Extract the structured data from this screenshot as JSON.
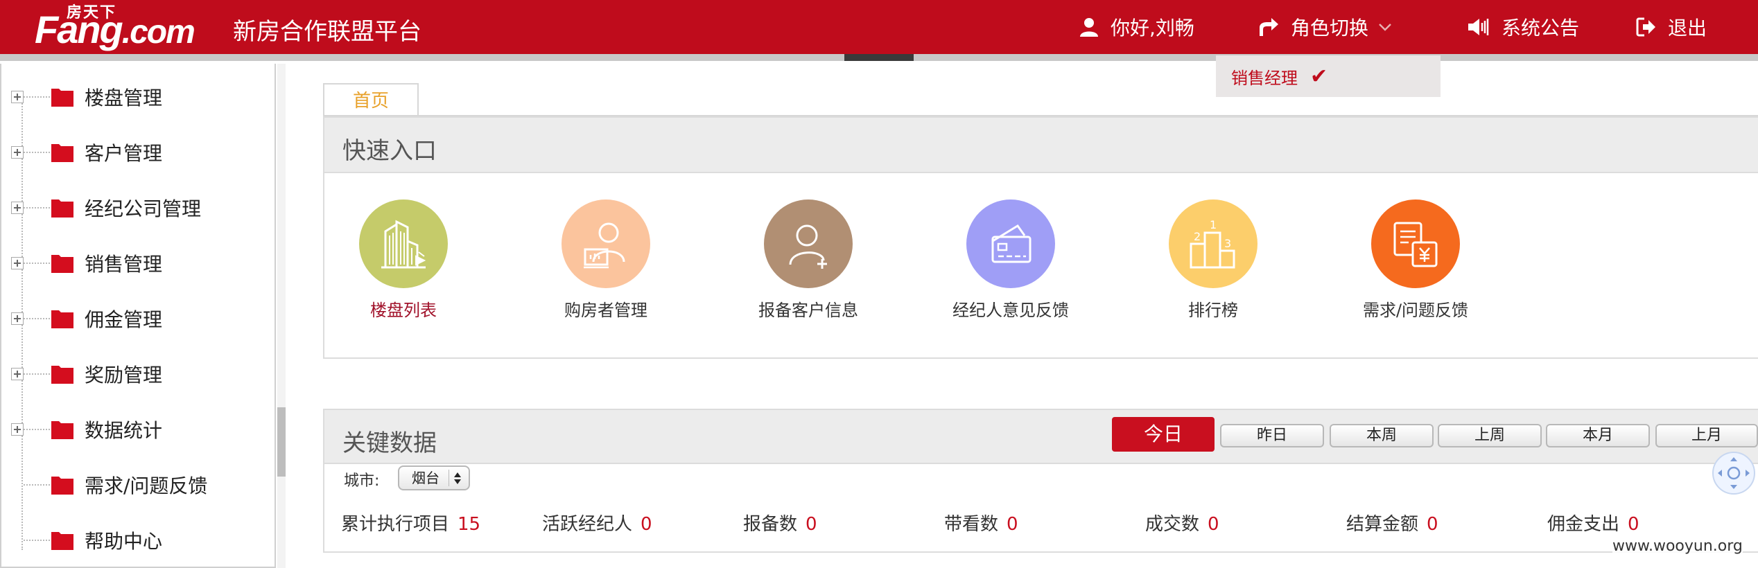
{
  "header": {
    "logo_sub": "房天下",
    "logo_main": "Fang",
    "logo_domain": ".com",
    "site_title": "新房合作联盟平台",
    "greeting": "你好,刘畅",
    "role_switch": "角色切换",
    "notice": "系统公告",
    "logout": "退出"
  },
  "role_dropdown": {
    "option": "销售经理",
    "check": "✔"
  },
  "sidebar": {
    "items": [
      {
        "label": "楼盘管理"
      },
      {
        "label": "客户管理"
      },
      {
        "label": "经纪公司管理"
      },
      {
        "label": "销售管理"
      },
      {
        "label": "佣金管理"
      },
      {
        "label": "奖励管理"
      },
      {
        "label": "数据统计"
      },
      {
        "label": "需求/问题反馈"
      },
      {
        "label": "帮助中心"
      }
    ]
  },
  "tabs": {
    "home": "首页"
  },
  "quick_entry": {
    "title": "快速入口",
    "items": [
      {
        "label": "楼盘列表",
        "color": "#c5cb6a",
        "icon": "buildings-icon"
      },
      {
        "label": "购房者管理",
        "color": "#fbc49d",
        "icon": "buyer-icon"
      },
      {
        "label": "报备客户信息",
        "color": "#b18f73",
        "icon": "add-user-icon"
      },
      {
        "label": "经纪人意见反馈",
        "color": "#9f9ef6",
        "icon": "card-icon"
      },
      {
        "label": "排行榜",
        "color": "#fcce6b",
        "icon": "podium-icon"
      },
      {
        "label": "需求/问题反馈",
        "color": "#f56a1e",
        "icon": "yuan-document-icon"
      }
    ]
  },
  "key_data": {
    "title": "关键数据",
    "periods": [
      "今日",
      "昨日",
      "本周",
      "上周",
      "本月",
      "上月"
    ],
    "city_label": "城市:",
    "city_value": "烟台",
    "stats": [
      {
        "label": "累计执行项目",
        "value": "15"
      },
      {
        "label": "活跃经纪人",
        "value": "0"
      },
      {
        "label": "报备数",
        "value": "0"
      },
      {
        "label": "带看数",
        "value": "0"
      },
      {
        "label": "成交数",
        "value": "0"
      },
      {
        "label": "结算金额",
        "value": "0"
      },
      {
        "label": "佣金支出",
        "value": "0"
      }
    ]
  },
  "watermark": "www.wooyun.org",
  "colors": {
    "brand_red": "#bf0c1c",
    "accent_orange": "#e8a12a",
    "value_red": "#c90f1f"
  }
}
